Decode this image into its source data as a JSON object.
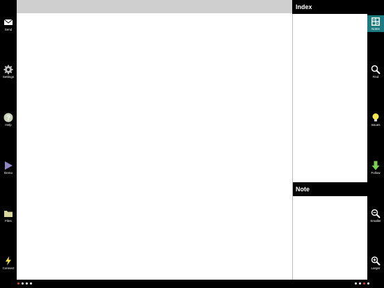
{
  "left_toolbar": [
    {
      "label": "Send",
      "icon": "envelope-icon"
    },
    {
      "label": "Settings",
      "icon": "gear-icon"
    },
    {
      "label": "Help",
      "icon": "question-icon"
    },
    {
      "label": "Demo",
      "icon": "play-icon"
    },
    {
      "label": "Files",
      "icon": "folder-icon"
    },
    {
      "label": "Connect",
      "icon": "lightning-icon"
    }
  ],
  "right_toolbar": [
    {
      "label": "Notes",
      "icon": "notes-icon",
      "active": true
    },
    {
      "label": "Find",
      "icon": "magnifier-icon"
    },
    {
      "label": "Issues",
      "icon": "lightbulb-icon"
    },
    {
      "label": "Follow",
      "icon": "arrow-down-icon"
    },
    {
      "label": "Smaller",
      "icon": "zoom-out-icon"
    },
    {
      "label": "Larger",
      "icon": "zoom-in-icon"
    }
  ],
  "panels": {
    "index_title": "Index",
    "note_title": "Note"
  },
  "colors": {
    "accent": "#1c7a82",
    "background": "#000000",
    "page": "#ffffff",
    "top_strip": "#cfcfcf"
  }
}
